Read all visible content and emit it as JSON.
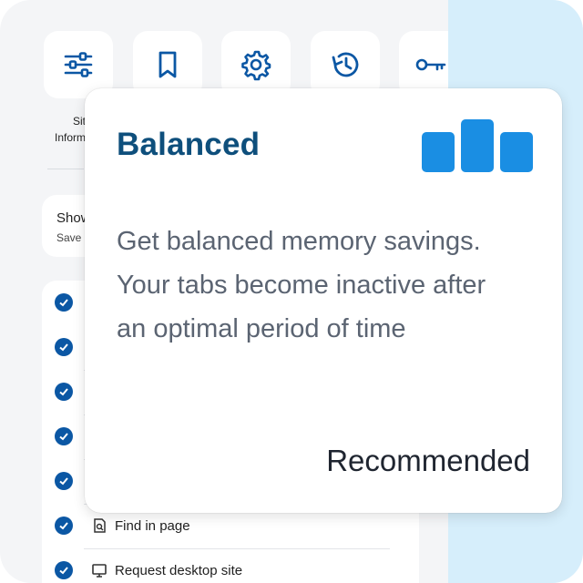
{
  "background": {
    "shortcuts": [
      {
        "icon": "sliders-icon",
        "label_line1": "Sit",
        "label_line2": "Inform"
      },
      {
        "icon": "bookmark-icon",
        "label_line1": "",
        "label_line2": ""
      },
      {
        "icon": "gear-icon",
        "label_line1": "",
        "label_line2": ""
      },
      {
        "icon": "history-icon",
        "label_line1": "",
        "label_line2": ""
      },
      {
        "icon": "key-icon",
        "label_line1": "",
        "label_line2": ""
      }
    ],
    "settings_card": {
      "title": "Show",
      "subtitle": "Save"
    },
    "menu": {
      "find_in_page": "Find in page",
      "request_desktop_site": "Request desktop site"
    }
  },
  "popup": {
    "title": "Balanced",
    "description": "Get balanced memory savings. Your tabs become inactive after an optimal period of time",
    "footer": "Recommended",
    "icon": "balanced-bars-icon",
    "accent": "#0e4f7c",
    "bar_color": "#1a8ee3"
  },
  "colors": {
    "icon_blue": "#0b57a4",
    "frame_bg": "#f4f5f7",
    "right_panel": "#d6eefb"
  }
}
